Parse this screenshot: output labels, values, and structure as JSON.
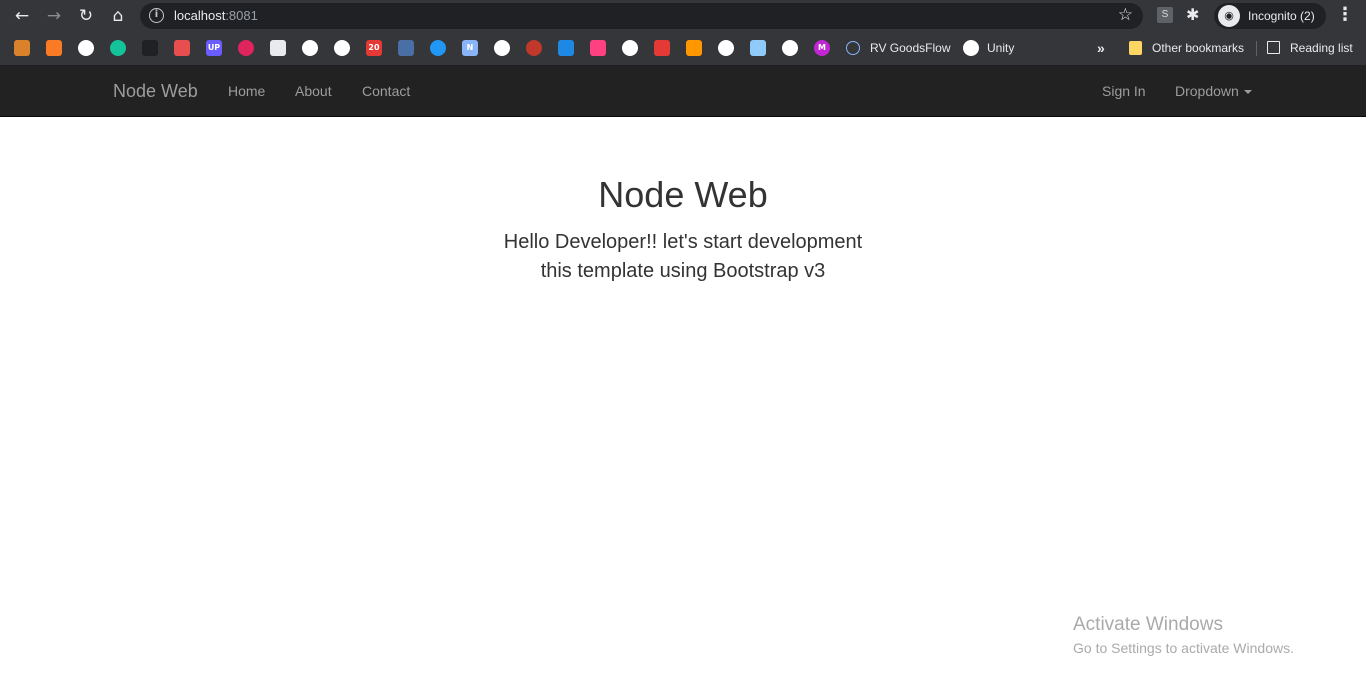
{
  "browser": {
    "url_host": "localhost",
    "url_port": ":8081",
    "profile_label": "Incognito (2)",
    "extension_label": "S",
    "more_bookmarks_glyph": "»"
  },
  "bookmarks": {
    "items": [
      {
        "icon": "ms-logo-icon",
        "color": "#d9822b"
      },
      {
        "icon": "xampp-icon",
        "color": "#fb7a24"
      },
      {
        "icon": "globe-icon",
        "color": "#ffffff"
      },
      {
        "icon": "grammarly-icon",
        "color": "#15c39a"
      },
      {
        "icon": "ninja-icon",
        "color": "#202124"
      },
      {
        "icon": "asterisk-icon",
        "color": "#e94e4e"
      },
      {
        "icon": "upwork-icon",
        "color": "#6b5cff",
        "text": "UP"
      },
      {
        "icon": "video-icon",
        "color": "#e0245e"
      },
      {
        "icon": "hat-icon",
        "color": "#e8eaed"
      },
      {
        "icon": "globe-icon",
        "color": "#ffffff"
      },
      {
        "icon": "globe-icon",
        "color": "#ffffff"
      },
      {
        "icon": "red-badge-icon",
        "color": "#e53935",
        "text": "20"
      },
      {
        "icon": "crown-dots-icon",
        "color": "#4a6fa5"
      },
      {
        "icon": "drop-icon",
        "color": "#2196f3"
      },
      {
        "icon": "n-icon",
        "color": "#8ab4f8",
        "text": "N"
      },
      {
        "icon": "globe-icon",
        "color": "#ffffff"
      },
      {
        "icon": "sphere-icon",
        "color": "#c0392b"
      },
      {
        "icon": "v-icon",
        "color": "#1e88e5"
      },
      {
        "icon": "bars-icon",
        "color": "#ff4081"
      },
      {
        "icon": "globe-icon",
        "color": "#ffffff"
      },
      {
        "icon": "bird-icon",
        "color": "#e53935"
      },
      {
        "icon": "crown-icon",
        "color": "#ff9800"
      },
      {
        "icon": "globe-icon",
        "color": "#ffffff"
      },
      {
        "icon": "photo-icon",
        "color": "#90caf9"
      },
      {
        "icon": "goggles-icon",
        "color": "#ffffff"
      },
      {
        "icon": "m-icon",
        "color": "#c026d3",
        "text": "M"
      }
    ],
    "rv_goodsflow": "RV GoodsFlow",
    "unity": "Unity",
    "other_bookmarks": "Other bookmarks",
    "reading_list": "Reading list"
  },
  "navbar": {
    "brand": "Node Web",
    "links": [
      "Home",
      "About",
      "Contact"
    ],
    "sign_in": "Sign In",
    "dropdown": "Dropdown"
  },
  "hero": {
    "title": "Node Web",
    "line1": "Hello Developer!! let's start development",
    "line2": "this template using Bootstrap v3"
  },
  "watermark": {
    "title": "Activate Windows",
    "subtitle": "Go to Settings to activate Windows."
  }
}
